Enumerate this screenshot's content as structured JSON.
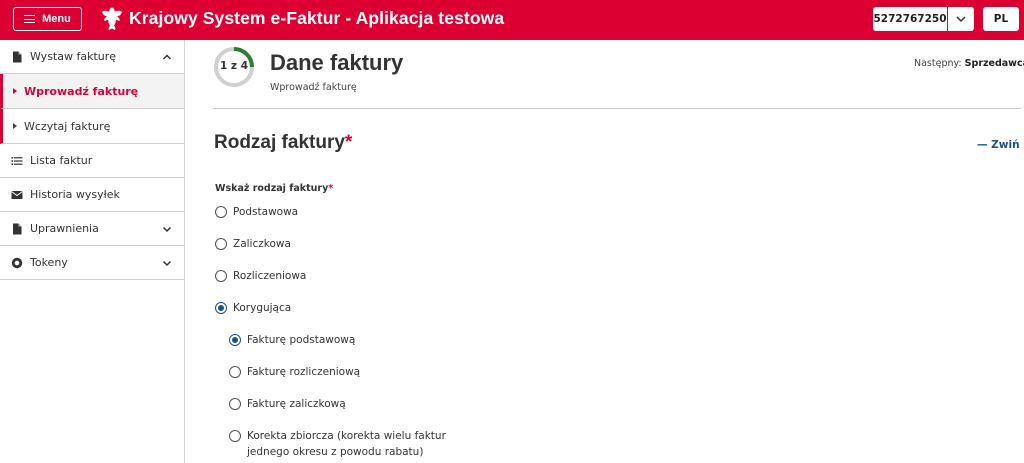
{
  "header": {
    "menu_label": "Menu",
    "app_title": "Krajowy System e-Faktur - Aplikacja testowa",
    "nip": "5272767250",
    "language": "PL"
  },
  "sidebar": {
    "items": [
      {
        "label": "Wystaw fakturę",
        "icon": "document-icon",
        "expanded": true
      },
      {
        "label": "Wprowadź fakturę",
        "active": true
      },
      {
        "label": "Wczytaj fakturę"
      },
      {
        "label": "Lista faktur",
        "icon": "list-icon"
      },
      {
        "label": "Historia wysyłek",
        "icon": "envelope-icon"
      },
      {
        "label": "Uprawnienia",
        "icon": "document-icon",
        "expanded": false
      },
      {
        "label": "Tokeny",
        "icon": "token-icon",
        "expanded": false
      }
    ]
  },
  "main": {
    "step_label": "1 z 4",
    "step_progress": 0.25,
    "title": "Dane faktury",
    "subtitle": "Wprowadź fakturę",
    "next_prefix": "Następny:",
    "next_value": "Sprzedawca",
    "section_title": "Rodzaj faktury",
    "required_mark": "*",
    "collapse_label": "Zwiń",
    "field_label": "Wskaż rodzaj faktury",
    "invoice_types": [
      {
        "label": "Podstawowa",
        "checked": false
      },
      {
        "label": "Zaliczkowa",
        "checked": false
      },
      {
        "label": "Rozliczeniowa",
        "checked": false
      },
      {
        "label": "Korygująca",
        "checked": true
      }
    ],
    "correction_types": [
      {
        "label": "Fakturę podstawową",
        "checked": true
      },
      {
        "label": "Fakturę rozliczeniową",
        "checked": false
      },
      {
        "label": "Fakturę zaliczkową",
        "checked": false
      },
      {
        "label": "Korekta zbiorcza (korekta wielu faktur jednego okresu z powodu rabatu)",
        "checked": false
      }
    ]
  },
  "colors": {
    "brand_red": "#dc0032",
    "accent_blue": "#1a4f8b",
    "progress_green": "#2e7d32"
  }
}
